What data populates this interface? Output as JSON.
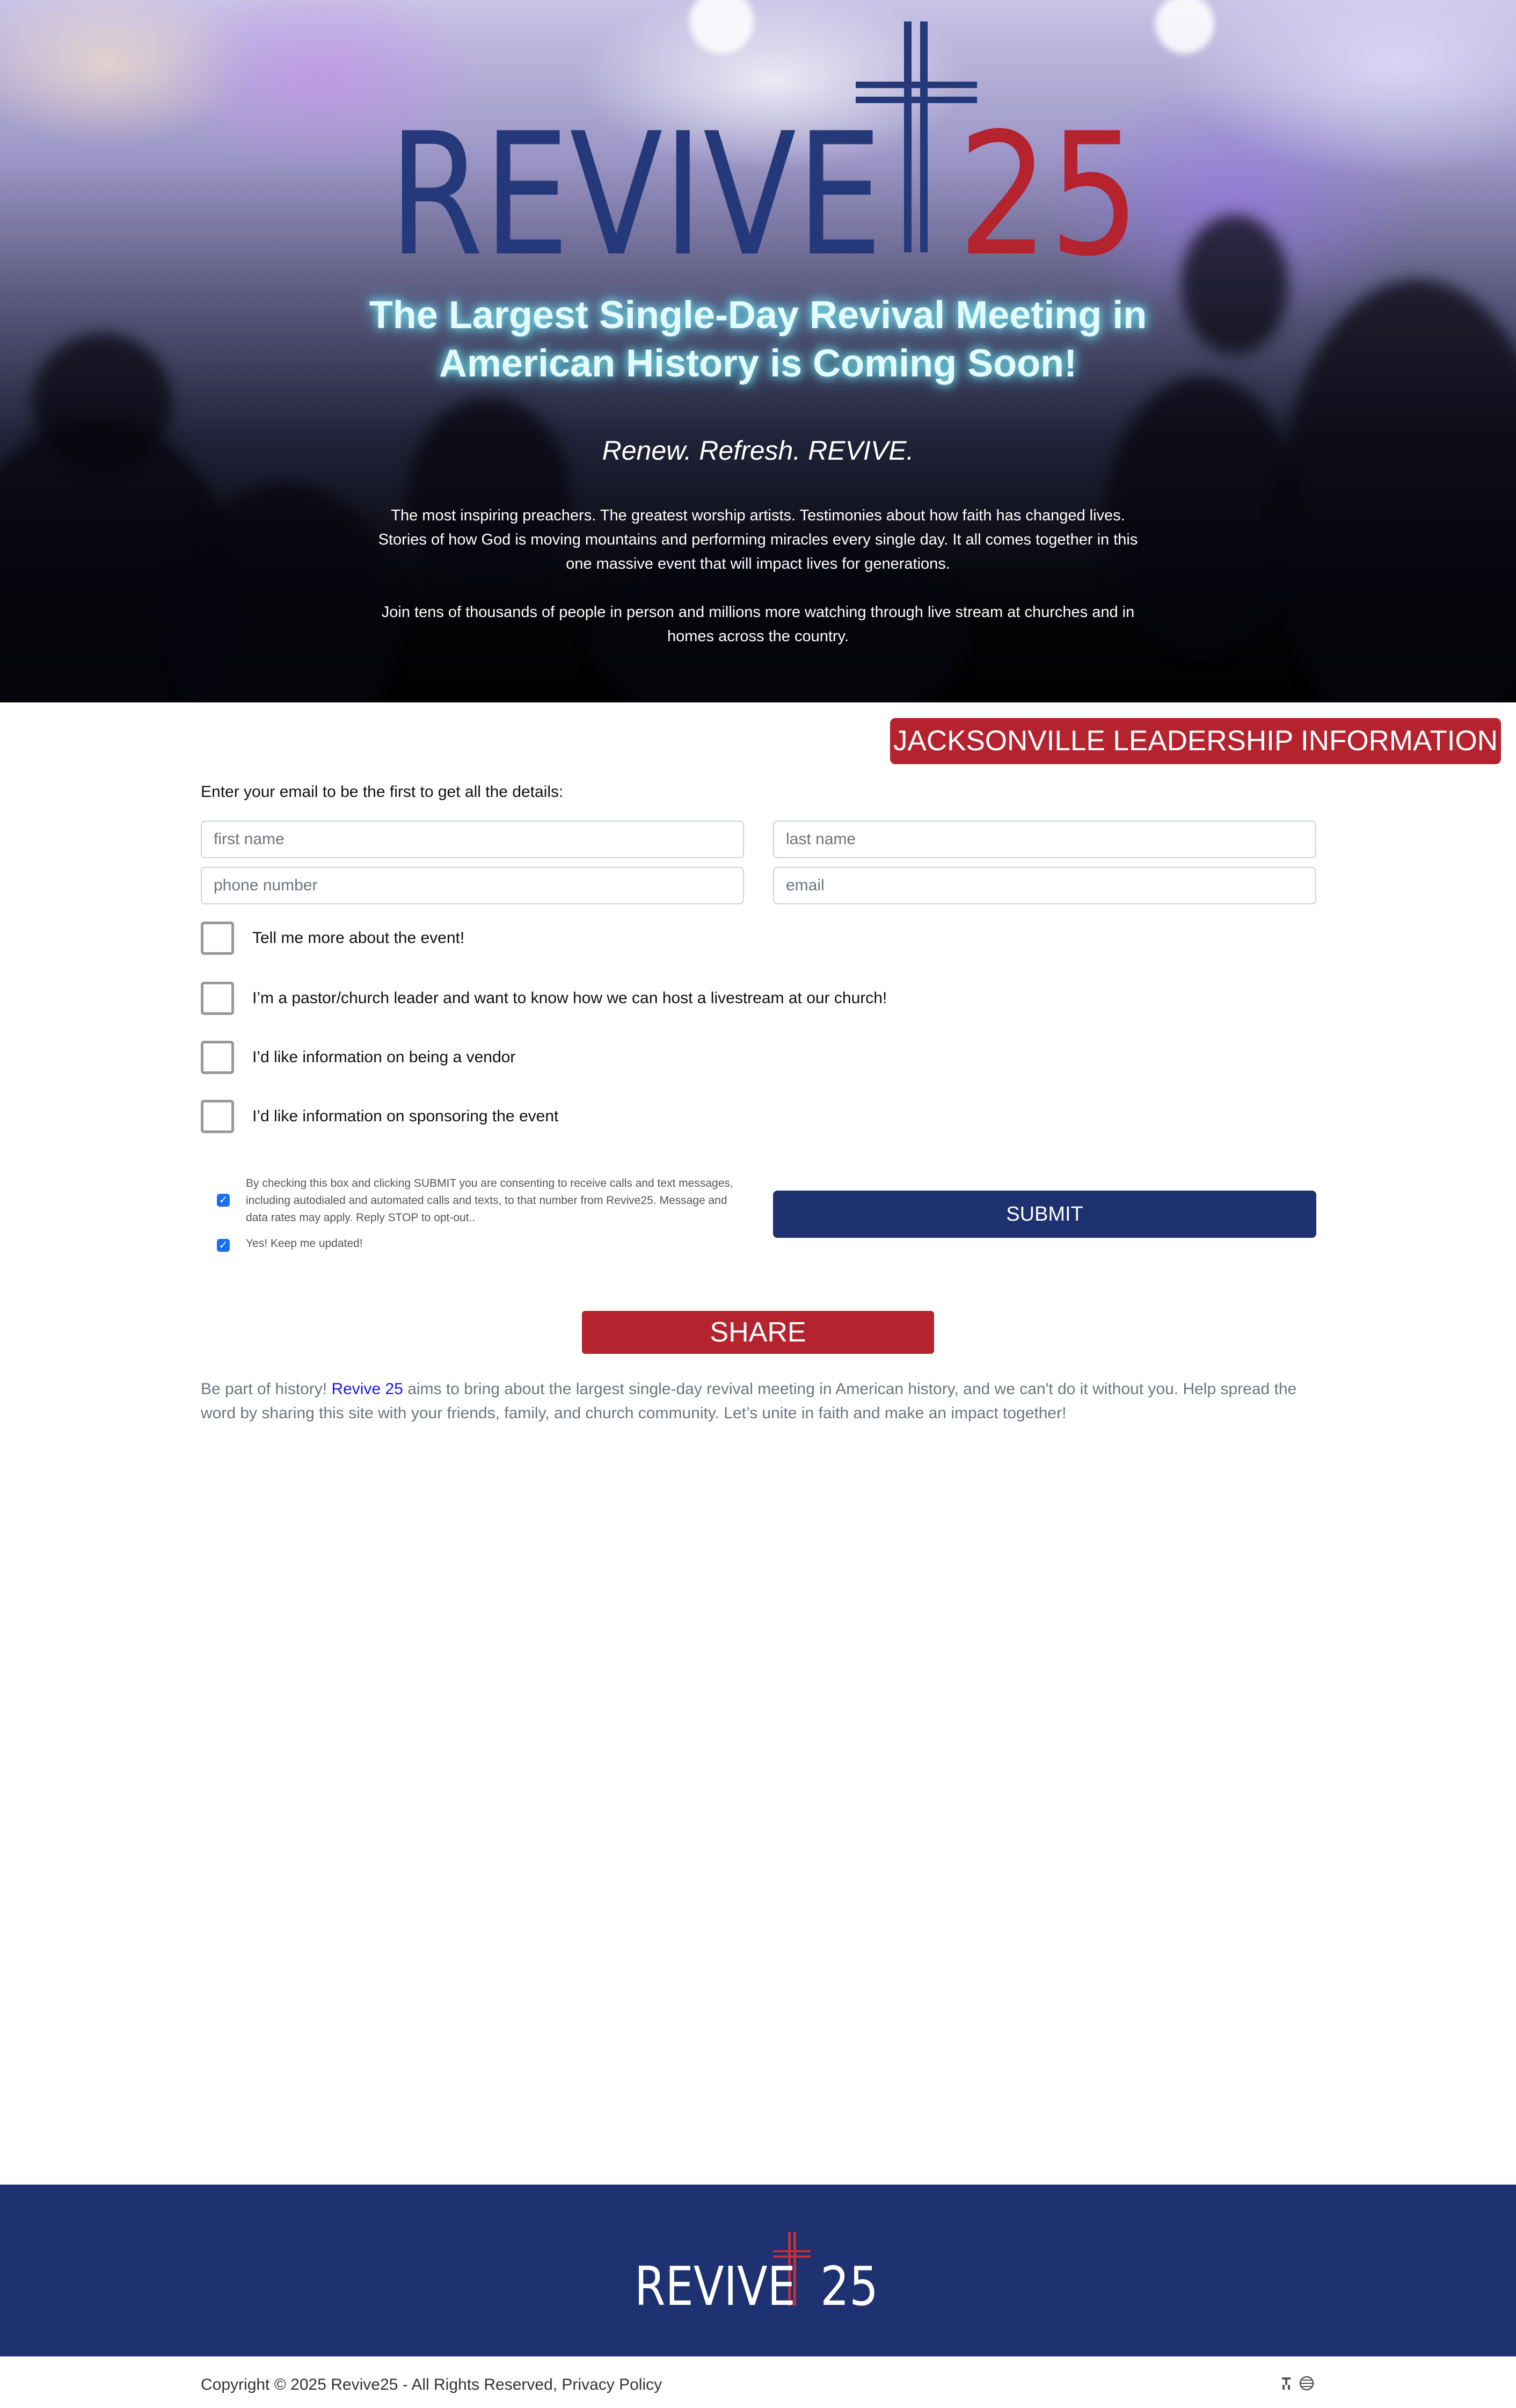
{
  "hero": {
    "logo_word": "REVIVE",
    "logo_number": "25",
    "title": "The Largest Single-Day Revival Meeting in American History is Coming Soon!",
    "tagline": "Renew. Refresh. REVIVE.",
    "paragraph_1": "The most inspiring preachers. The greatest worship artists. Testimonies about how faith has changed lives. Stories of how God is moving mountains and performing miracles every single day. It all comes together in this one massive event that will impact lives for generations.",
    "paragraph_2": "Join tens of thousands of people in person and millions more watching through live stream at churches and in homes across the country."
  },
  "leadership_button": "JACKSONVILLE LEADERSHIP INFORMATION",
  "form": {
    "intro": "Enter your email to be the first to get all the details:",
    "first_name_placeholder": "first name",
    "last_name_placeholder": "last name",
    "phone_placeholder": "phone number",
    "email_placeholder": "email",
    "options": [
      "Tell me more about the event!",
      "I’m a pastor/church leader and want to know how we can host a livestream at our church!",
      "I’d like information on being a vendor",
      "I’d like information on sponsoring the event"
    ],
    "consent_text": "By checking this box and clicking SUBMIT you are consenting to receive calls and text messages, including autodialed and automated calls and texts, to that number from Revive25. Message and data rates may apply. Reply STOP to opt-out..",
    "consent_checked": true,
    "updates_text": "Yes! Keep me updated!",
    "updates_checked": true,
    "submit_label": "SUBMIT"
  },
  "share": {
    "button_label": "SHARE",
    "text_before": "Be part of history! ",
    "link_text": "Revive 25",
    "text_after": " aims to bring about the largest single-day revival meeting in American history, and we can't do it without you. Help spread the word by sharing this site with your friends, family, and church community. Let’s unite in faith and make an impact together!"
  },
  "footer": {
    "logo_word": "REVIVE",
    "logo_number": "25",
    "copyright": "Copyright © 2025 Revive25 - All Rights Reserved, Privacy Policy",
    "icons": [
      "accessibility-icon",
      "globe-icon"
    ]
  },
  "colors": {
    "navy": "#1e3170",
    "red": "#b5232f",
    "glow": "#7fe9f5",
    "link": "#1a1ae6"
  }
}
